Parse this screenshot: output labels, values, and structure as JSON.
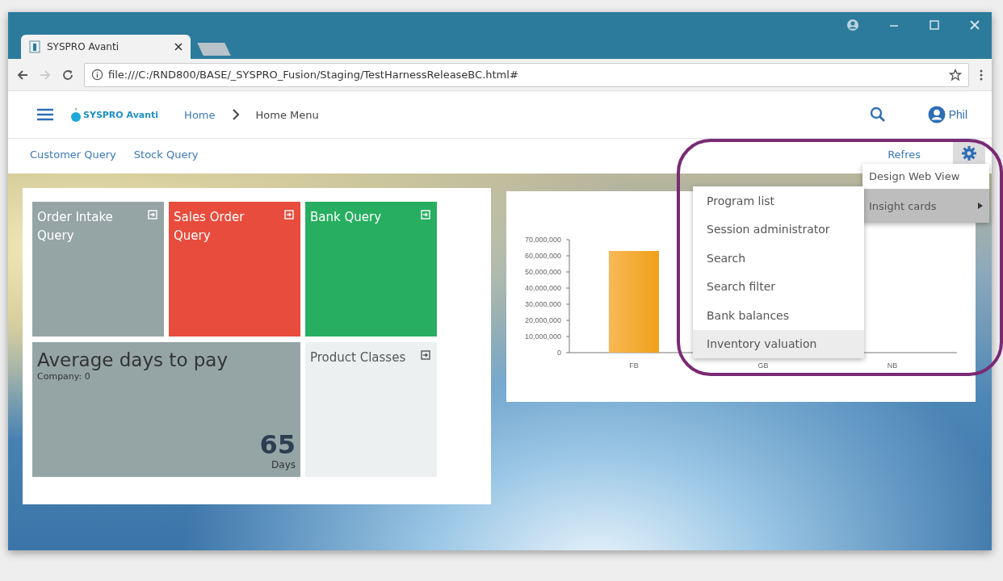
{
  "browser": {
    "tabs": [
      {
        "title": "SYSPRO Avanti",
        "selected": true
      }
    ],
    "address": "file:///C:/RND800/BASE/_SYSPRO_Fusion/Staging/TestHarnessReleaseBC.html#"
  },
  "app_header": {
    "logo": "SYSPRO Avanti",
    "breadcrumbs": [
      {
        "label": "Home",
        "kind": "link"
      },
      {
        "label": "Home Menu",
        "kind": "current"
      }
    ],
    "user": "Phil"
  },
  "toolbar": {
    "links": [
      "Customer Query",
      "Stock Query"
    ],
    "refresh": "Refres"
  },
  "tiles": [
    {
      "kind": "query",
      "title": "Order Intake Query",
      "color": "#95a5a6"
    },
    {
      "kind": "query",
      "title": "Sales Order Query",
      "color": "#e74c3c"
    },
    {
      "kind": "query",
      "title": "Bank Query",
      "color": "#27ae60"
    },
    {
      "kind": "metric",
      "title": "Average days to pay",
      "subtitle": "Company: 0",
      "value": "65",
      "unit": "Days",
      "color": "#95a5a6"
    },
    {
      "kind": "list",
      "title": "Product Classes",
      "color": "#ecf0f1"
    }
  ],
  "chart": {
    "chart_data": {
      "type": "bar",
      "categories": [
        "FB",
        "GB",
        "NB"
      ],
      "values": [
        63000000,
        null,
        0
      ],
      "ylim": [
        0,
        70000000
      ],
      "yticks": [
        {
          "value": 0,
          "label": "0"
        },
        {
          "value": 10000000,
          "label": "10,000,000"
        },
        {
          "value": 20000000,
          "label": "20,000,000"
        },
        {
          "value": 30000000,
          "label": "30,000,000"
        },
        {
          "value": 40000000,
          "label": "40,000,000"
        },
        {
          "value": 50000000,
          "label": "50,000,000"
        },
        {
          "value": 60000000,
          "label": "60,000,000"
        },
        {
          "value": 70000000,
          "label": "70,000,000"
        }
      ]
    }
  },
  "menu": {
    "items": [
      {
        "label": "Design Web View",
        "selected": false,
        "has_submenu": false
      },
      {
        "label": "Insight cards",
        "selected": true,
        "has_submenu": true
      }
    ]
  },
  "submenu": {
    "items": [
      {
        "label": "Program list",
        "selected": false
      },
      {
        "label": "Session administrator",
        "selected": false
      },
      {
        "label": "Search",
        "selected": false
      },
      {
        "label": "Search filter",
        "selected": false
      },
      {
        "label": "Bank balances",
        "selected": false
      },
      {
        "label": "Inventory valuation",
        "selected": true
      }
    ]
  }
}
